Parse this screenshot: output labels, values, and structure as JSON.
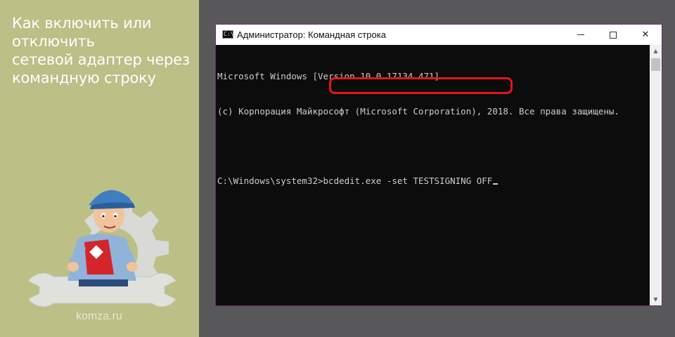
{
  "article": {
    "title": "Как включить или отключить\nсетевой адаптер через\nкомандную строку",
    "site": "komza.ru"
  },
  "window": {
    "title": "Администратор: Командная строка",
    "icon_label": "C:\\.",
    "minimize_icon": "minimize-icon",
    "maximize_icon": "maximize-icon",
    "close_glyph": "✕"
  },
  "console": {
    "line1": "Microsoft Windows [Version 10.0.17134.471]",
    "line2": "(c) Корпорация Майкрософт (Microsoft Corporation), 2018. Все права защищены.",
    "prompt": "C:\\Windows\\system32>",
    "command": "bcdedit.exe -set TESTSIGNING OFF"
  },
  "scrollbar": {
    "up_glyph": "▲",
    "down_glyph": "▼"
  },
  "colors": {
    "left_panel": "#bcbf86",
    "background": "#58585a",
    "console_bg": "#0c0c0c",
    "console_text": "#cccccc",
    "highlight": "#e3141e",
    "window_border": "#6b2d6b"
  }
}
